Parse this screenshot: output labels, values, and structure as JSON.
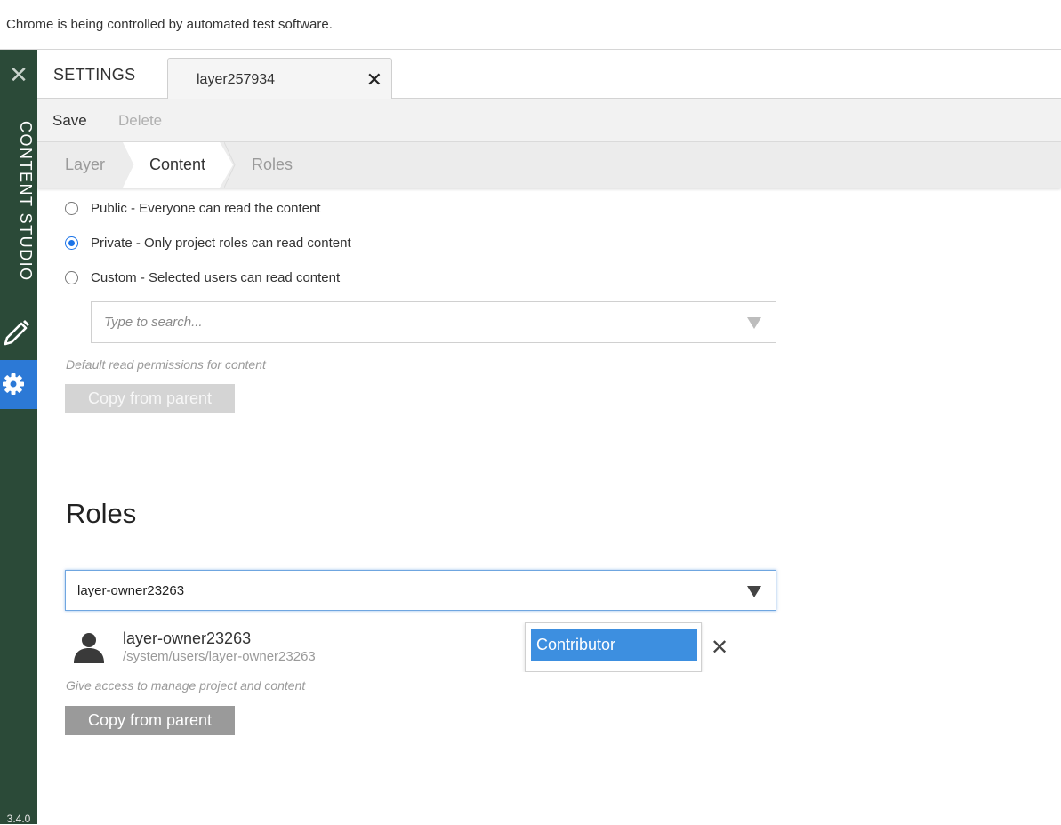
{
  "infobar": {
    "text": "Chrome is being controlled by automated test software."
  },
  "sidebar": {
    "close_icon": "close-icon",
    "app_title": "CONTENT STUDIO",
    "edit_icon": "pencil-icon",
    "settings_icon": "gear-icon",
    "version": "3.4.0",
    "colors": {
      "background": "#2b4a38",
      "active": "#2c79d6"
    }
  },
  "header": {
    "section_label": "SETTINGS",
    "tab": {
      "label": "layer257934",
      "close_icon": "close-icon"
    }
  },
  "toolbar": {
    "save_label": "Save",
    "delete_label": "Delete"
  },
  "steps": [
    {
      "label": "Layer",
      "active": false
    },
    {
      "label": "Content",
      "active": true
    },
    {
      "label": "Roles",
      "active": false
    }
  ],
  "read_access": {
    "options": [
      {
        "label": "Public - Everyone can read the content",
        "checked": false
      },
      {
        "label": "Private - Only project roles can read content",
        "checked": true
      },
      {
        "label": "Custom - Selected users can read content",
        "checked": false
      }
    ],
    "search_placeholder": "Type to search...",
    "help_text": "Default read permissions for content",
    "copy_button": "Copy from parent"
  },
  "roles": {
    "title": "Roles",
    "input_value": "layer-owner23263",
    "user": {
      "name": "layer-owner23263",
      "path": "/system/users/layer-owner23263",
      "selected_role": "Contributor"
    },
    "help_text": "Give access to manage project and content",
    "copy_button": "Copy from parent"
  }
}
